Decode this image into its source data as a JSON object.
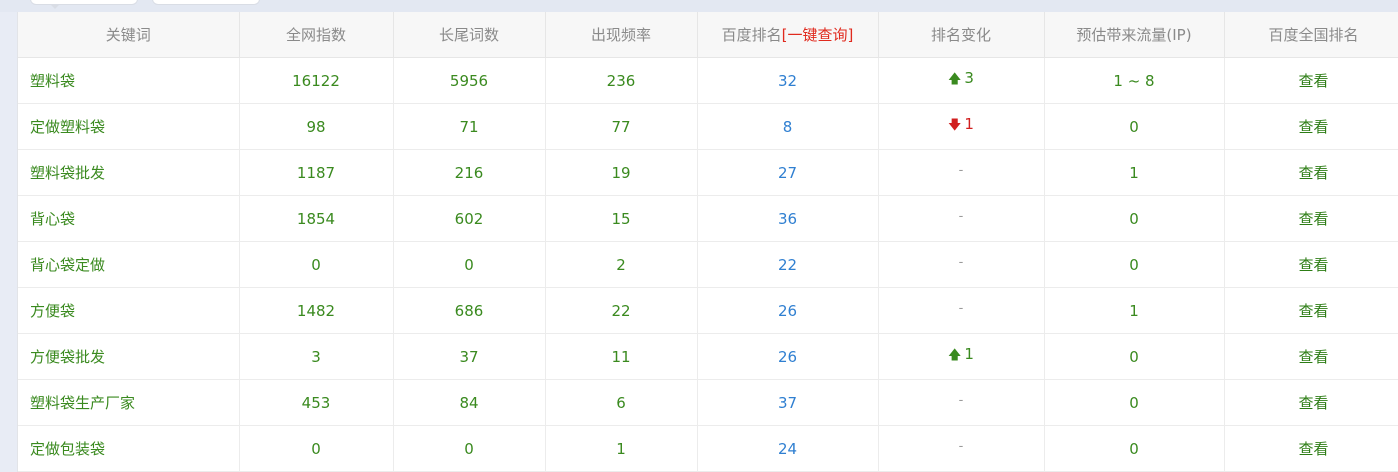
{
  "table": {
    "headers": {
      "keyword": "关键词",
      "index": "全网指数",
      "longtail": "长尾词数",
      "frequency": "出现频率",
      "rank": "百度排名",
      "rank_link": "[一键查询]",
      "change": "排名变化",
      "traffic": "预估带来流量(IP)",
      "national": "百度全国排名"
    },
    "rows": [
      {
        "keyword": "塑料袋",
        "index": "16122",
        "longtail": "5956",
        "frequency": "236",
        "rank": "32",
        "change_dir": "up",
        "change": "3",
        "traffic": "1 ~ 8",
        "view": "查看"
      },
      {
        "keyword": "定做塑料袋",
        "index": "98",
        "longtail": "71",
        "frequency": "77",
        "rank": "8",
        "change_dir": "down",
        "change": "1",
        "traffic": "0",
        "view": "查看"
      },
      {
        "keyword": "塑料袋批发",
        "index": "1187",
        "longtail": "216",
        "frequency": "19",
        "rank": "27",
        "change_dir": "none",
        "change": "-",
        "traffic": "1",
        "view": "查看"
      },
      {
        "keyword": "背心袋",
        "index": "1854",
        "longtail": "602",
        "frequency": "15",
        "rank": "36",
        "change_dir": "none",
        "change": "-",
        "traffic": "0",
        "view": "查看"
      },
      {
        "keyword": "背心袋定做",
        "index": "0",
        "longtail": "0",
        "frequency": "2",
        "rank": "22",
        "change_dir": "none",
        "change": "-",
        "traffic": "0",
        "view": "查看"
      },
      {
        "keyword": "方便袋",
        "index": "1482",
        "longtail": "686",
        "frequency": "22",
        "rank": "26",
        "change_dir": "none",
        "change": "-",
        "traffic": "1",
        "view": "查看"
      },
      {
        "keyword": "方便袋批发",
        "index": "3",
        "longtail": "37",
        "frequency": "11",
        "rank": "26",
        "change_dir": "up",
        "change": "1",
        "traffic": "0",
        "view": "查看"
      },
      {
        "keyword": "塑料袋生产厂家",
        "index": "453",
        "longtail": "84",
        "frequency": "6",
        "rank": "37",
        "change_dir": "none",
        "change": "-",
        "traffic": "0",
        "view": "查看"
      },
      {
        "keyword": "定做包装袋",
        "index": "0",
        "longtail": "0",
        "frequency": "1",
        "rank": "24",
        "change_dir": "none",
        "change": "-",
        "traffic": "0",
        "view": "查看"
      }
    ]
  },
  "colors": {
    "header_bg": "#f7f7f7",
    "green_text": "#3a8a1f",
    "rank_blue": "#2f7fd1",
    "highlight_red": "#e02a1e",
    "down_red": "#d11f1f"
  },
  "icons": {
    "up": "arrow-up-icon",
    "down": "arrow-down-icon",
    "none": "dash-icon"
  }
}
